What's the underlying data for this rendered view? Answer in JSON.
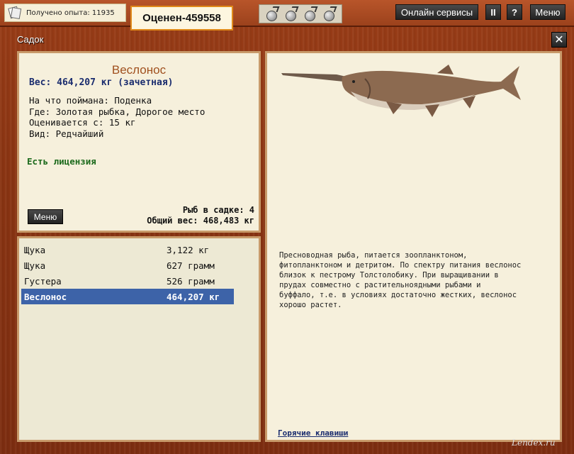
{
  "header": {
    "experience_text": "Получено опыта: 11935",
    "rated_text": "Оценен-459558",
    "online_services": "Онлайн сервисы",
    "pause_label": "II",
    "help_label": "?",
    "menu_label": "Меню"
  },
  "window": {
    "title": "Садок",
    "close_label": "✕"
  },
  "fish_info": {
    "name": "Веслонос",
    "weight": "Вес: 464,207 кг (зачетная)",
    "caught_on": "На что поймана: Поденка",
    "location": "Где: Золотая рыбка, Дорогое место",
    "rated_from": "Оценивается с: 15 кг",
    "kind": "Вид: Редчайший",
    "license": "Есть лицензия",
    "menu_button": "Меню",
    "fish_count": "Рыб в садке: 4",
    "total_weight": "Общий вес: 468,483 кг"
  },
  "catch_list": [
    {
      "name": "Щука",
      "weight": "3,122 кг",
      "selected": false
    },
    {
      "name": "Щука",
      "weight": "627 грамм",
      "selected": false
    },
    {
      "name": "Густера",
      "weight": "526 грамм",
      "selected": false
    },
    {
      "name": "Веслонос",
      "weight": "464,207 кг",
      "selected": true
    }
  ],
  "description": {
    "line1": "Пресноводная рыба, питается зоопланктоном,",
    "line2": "фитопланктоном и детритом. По спектру питания веслонос",
    "line3": "близок к пестрому Толстолобику. При выращивании в",
    "line4": "прудах совместно с растительноядными рыбами и",
    "line5": "буффало, т.е. в условиях достаточно жестких, веслонос",
    "line6": "хорошо растет."
  },
  "hotkeys_link": "Горячие клавиши",
  "watermark": "Lendex.ru",
  "icons": [
    "pages-icon",
    "bait-icon",
    "pause-icon",
    "help-icon",
    "close-icon"
  ]
}
